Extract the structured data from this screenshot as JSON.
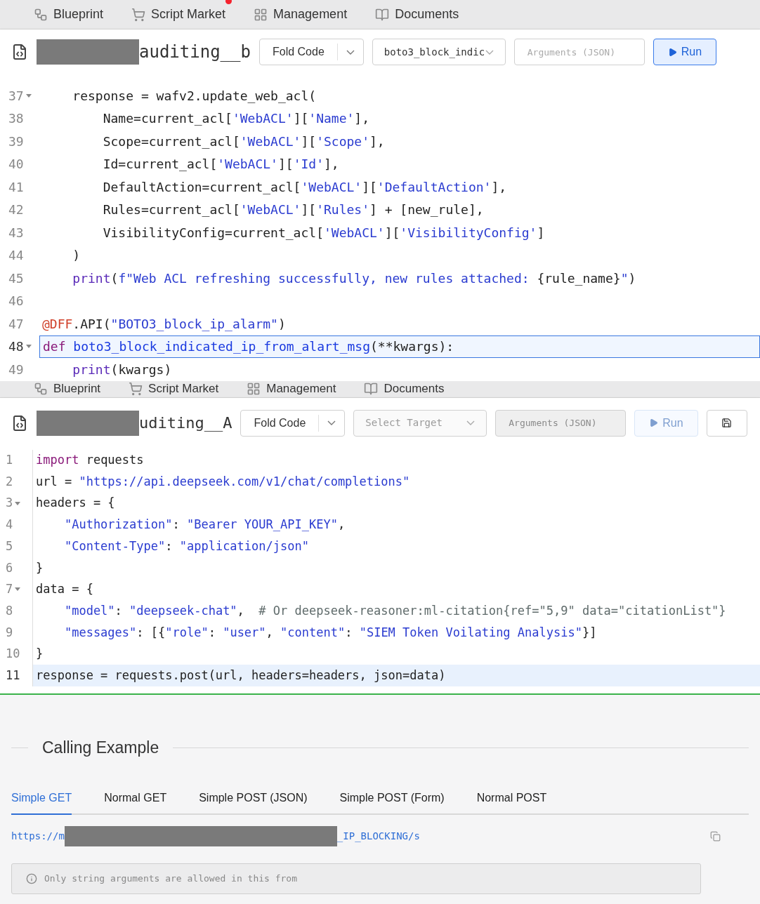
{
  "screens": [
    {
      "nav": [
        {
          "kind": "blueprint",
          "label": "Blueprint",
          "badge": false
        },
        {
          "kind": "cart",
          "label": "Script Market",
          "badge": true
        },
        {
          "kind": "grid",
          "label": "Management",
          "badge": false
        },
        {
          "kind": "book",
          "label": "Documents",
          "badge": false
        }
      ],
      "toolbar": {
        "title": "auditing__b",
        "fold_button": "Fold Code",
        "target": {
          "value": "boto3_block_indic",
          "disabled": false
        },
        "arguments": {
          "placeholder": "Arguments (JSON)",
          "disabled": false
        },
        "run": {
          "label": "Run",
          "disabled": false
        }
      },
      "lines": [
        {
          "number": "37",
          "foldable": true,
          "active": false,
          "tokens": [
            {
              "kind": "plain",
              "text": "    response = wafv2.update_web_acl("
            }
          ]
        },
        {
          "number": "38",
          "foldable": false,
          "active": false,
          "tokens": [
            {
              "kind": "plain",
              "text": "        Name=current_acl["
            },
            {
              "kind": "string",
              "text": "'WebACL'"
            },
            {
              "kind": "plain",
              "text": "]["
            },
            {
              "kind": "string",
              "text": "'Name'"
            },
            {
              "kind": "plain",
              "text": "],"
            }
          ]
        },
        {
          "number": "39",
          "foldable": false,
          "active": false,
          "tokens": [
            {
              "kind": "plain",
              "text": "        Scope=current_acl["
            },
            {
              "kind": "string",
              "text": "'WebACL'"
            },
            {
              "kind": "plain",
              "text": "]["
            },
            {
              "kind": "string",
              "text": "'Scope'"
            },
            {
              "kind": "plain",
              "text": "],"
            }
          ]
        },
        {
          "number": "40",
          "foldable": false,
          "active": false,
          "tokens": [
            {
              "kind": "plain",
              "text": "        Id=current_acl["
            },
            {
              "kind": "string",
              "text": "'WebACL'"
            },
            {
              "kind": "plain",
              "text": "]["
            },
            {
              "kind": "string",
              "text": "'Id'"
            },
            {
              "kind": "plain",
              "text": "],"
            }
          ]
        },
        {
          "number": "41",
          "foldable": false,
          "active": false,
          "tokens": [
            {
              "kind": "plain",
              "text": "        DefaultAction=current_acl["
            },
            {
              "kind": "string",
              "text": "'WebACL'"
            },
            {
              "kind": "plain",
              "text": "]["
            },
            {
              "kind": "string",
              "text": "'DefaultAction'"
            },
            {
              "kind": "plain",
              "text": "],"
            }
          ]
        },
        {
          "number": "42",
          "foldable": false,
          "active": false,
          "tokens": [
            {
              "kind": "plain",
              "text": "        Rules=current_acl["
            },
            {
              "kind": "string",
              "text": "'WebACL'"
            },
            {
              "kind": "plain",
              "text": "]["
            },
            {
              "kind": "string",
              "text": "'Rules'"
            },
            {
              "kind": "plain",
              "text": "] + [new_rule],"
            }
          ]
        },
        {
          "number": "43",
          "foldable": false,
          "active": false,
          "tokens": [
            {
              "kind": "plain",
              "text": "        VisibilityConfig=current_acl["
            },
            {
              "kind": "string",
              "text": "'WebACL'"
            },
            {
              "kind": "plain",
              "text": "]["
            },
            {
              "kind": "string",
              "text": "'VisibilityConfig'"
            },
            {
              "kind": "plain",
              "text": "]"
            }
          ]
        },
        {
          "number": "44",
          "foldable": false,
          "active": false,
          "tokens": [
            {
              "kind": "plain",
              "text": "    )"
            }
          ]
        },
        {
          "number": "45",
          "foldable": false,
          "active": false,
          "tokens": [
            {
              "kind": "builtin",
              "text": "    print"
            },
            {
              "kind": "plain",
              "text": "("
            },
            {
              "kind": "string",
              "text": "f\"Web ACL refreshing successfully, new rules attached: "
            },
            {
              "kind": "plain",
              "text": "{rule_name}"
            },
            {
              "kind": "string",
              "text": "\""
            },
            {
              "kind": "plain",
              "text": ")"
            }
          ]
        },
        {
          "number": "46",
          "foldable": false,
          "active": false
        },
        {
          "number": "47",
          "foldable": false,
          "active": false,
          "tokens": [
            {
              "kind": "decorator",
              "text": "@DFF"
            },
            {
              "kind": "plain",
              "text": ".API("
            },
            {
              "kind": "string",
              "text": "\"BOTO3_block_ip_alarm\""
            },
            {
              "kind": "plain",
              "text": ")"
            }
          ]
        },
        {
          "number": "48",
          "foldable": true,
          "active": true,
          "tokens": [
            {
              "kind": "keyword",
              "text": "def "
            },
            {
              "kind": "defname",
              "text": "boto3_block_indicated_ip_from_alart_msg"
            },
            {
              "kind": "plain",
              "text": "(**kwargs):"
            }
          ]
        },
        {
          "number": "49",
          "foldable": false,
          "active": false,
          "tokens": [
            {
              "kind": "builtin",
              "text": "    print"
            },
            {
              "kind": "plain",
              "text": "(kwargs)"
            }
          ]
        }
      ]
    },
    {
      "nav": [
        {
          "kind": "blueprint",
          "label": "Blueprint",
          "badge": false
        },
        {
          "kind": "cart",
          "label": "Script Market",
          "badge": false
        },
        {
          "kind": "grid",
          "label": "Management",
          "badge": false
        },
        {
          "kind": "book",
          "label": "Documents",
          "badge": false
        }
      ],
      "toolbar": {
        "title": "uditing__A",
        "fold_button": "Fold Code",
        "target": {
          "placeholder": "Select Target",
          "disabled": true
        },
        "arguments": {
          "placeholder": "Arguments (JSON)",
          "disabled": true
        },
        "run": {
          "label": "Run",
          "disabled": true
        },
        "save": true
      },
      "lines": [
        {
          "number": "1",
          "foldable": false,
          "active": false,
          "tokens": [
            {
              "kind": "keyword",
              "text": "import"
            },
            {
              "kind": "plain",
              "text": " requests"
            }
          ]
        },
        {
          "number": "2",
          "foldable": false,
          "active": false,
          "tokens": [
            {
              "kind": "plain",
              "text": "url = "
            },
            {
              "kind": "string",
              "text": "\"https://api.deepseek.com/v1/chat/completions\""
            }
          ]
        },
        {
          "number": "3",
          "foldable": true,
          "active": false,
          "tokens": [
            {
              "kind": "plain",
              "text": "headers = {"
            }
          ]
        },
        {
          "number": "4",
          "foldable": false,
          "active": false,
          "tokens": [
            {
              "kind": "string",
              "text": "    \"Authorization\""
            },
            {
              "kind": "plain",
              "text": ": "
            },
            {
              "kind": "string",
              "text": "\"Bearer YOUR_API_KEY\""
            },
            {
              "kind": "plain",
              "text": ","
            }
          ]
        },
        {
          "number": "5",
          "foldable": false,
          "active": false,
          "tokens": [
            {
              "kind": "string",
              "text": "    \"Content-Type\""
            },
            {
              "kind": "plain",
              "text": ": "
            },
            {
              "kind": "string",
              "text": "\"application/json\""
            }
          ]
        },
        {
          "number": "6",
          "foldable": false,
          "active": false,
          "tokens": [
            {
              "kind": "plain",
              "text": "}"
            }
          ]
        },
        {
          "number": "7",
          "foldable": true,
          "active": false,
          "tokens": [
            {
              "kind": "plain",
              "text": "data = {"
            }
          ]
        },
        {
          "number": "8",
          "foldable": false,
          "active": false,
          "tokens": [
            {
              "kind": "string",
              "text": "    \"model\""
            },
            {
              "kind": "plain",
              "text": ": "
            },
            {
              "kind": "string",
              "text": "\"deepseek-chat\""
            },
            {
              "kind": "plain",
              "text": ",  "
            },
            {
              "kind": "comment",
              "text": "# Or deepseek-reasoner:ml-citation{ref=\"5,9\" data=\"citationList\"}"
            }
          ]
        },
        {
          "number": "9",
          "foldable": false,
          "active": false,
          "tokens": [
            {
              "kind": "string",
              "text": "    \"messages\""
            },
            {
              "kind": "plain",
              "text": ": [{"
            },
            {
              "kind": "string",
              "text": "\"role\""
            },
            {
              "kind": "plain",
              "text": ": "
            },
            {
              "kind": "string",
              "text": "\"user\""
            },
            {
              "kind": "plain",
              "text": ", "
            },
            {
              "kind": "string",
              "text": "\"content\""
            },
            {
              "kind": "plain",
              "text": ": "
            },
            {
              "kind": "string",
              "text": "\"SIEM Token Voilating Analysis\""
            },
            {
              "kind": "plain",
              "text": "}]"
            }
          ]
        },
        {
          "number": "10",
          "foldable": false,
          "active": false,
          "tokens": [
            {
              "kind": "plain",
              "text": "}"
            }
          ]
        },
        {
          "number": "11",
          "foldable": false,
          "active": true,
          "tokens": [
            {
              "kind": "plain",
              "text": "response = requests.post(url, headers=headers, json=data)"
            }
          ]
        }
      ]
    }
  ],
  "calling_example": {
    "heading": "Calling Example",
    "tabs": [
      {
        "label": "Simple GET",
        "selected": true
      },
      {
        "label": "Normal GET",
        "selected": false
      },
      {
        "label": "Simple POST (JSON)",
        "selected": false
      },
      {
        "label": "Simple POST (Form)",
        "selected": false
      },
      {
        "label": "Normal POST",
        "selected": false
      }
    ],
    "url_start": "https://m",
    "url_end": "_IP_BLOCKING/s",
    "notice": "Only string arguments are allowed in this from"
  }
}
